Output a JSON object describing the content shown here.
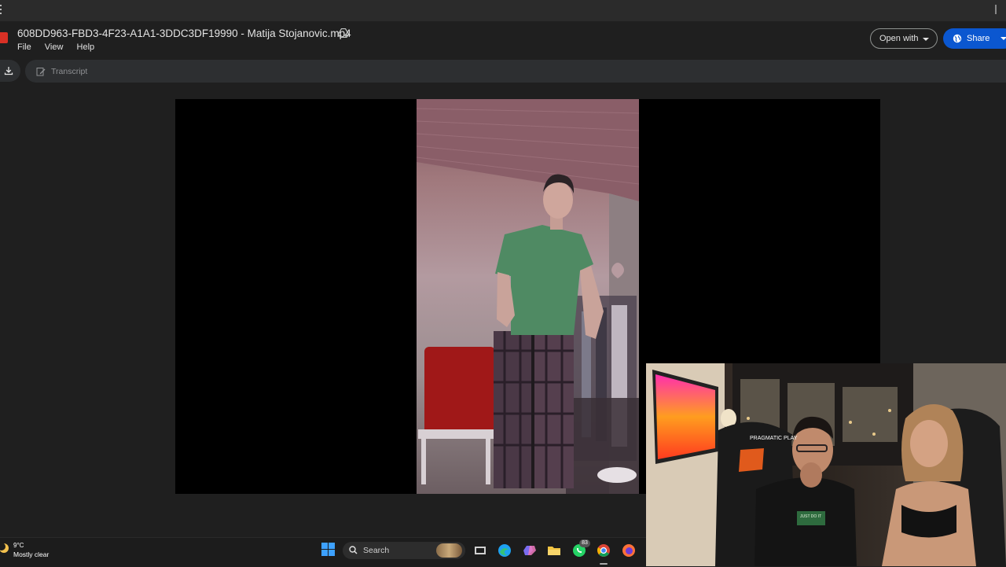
{
  "file": {
    "title": "608DD963-FBD3-4F23-A1A1-3DDC3DF19990 - Matija Stojanovic.mp4",
    "menu": [
      "File",
      "View",
      "Help"
    ]
  },
  "actions": {
    "open_with": "Open with",
    "share": "Share"
  },
  "toolbar": {
    "transcript": "Transcript"
  },
  "taskbar": {
    "weather_temp": "9°C",
    "weather_desc": "Mostly clear",
    "search_label": "Search",
    "whatsapp_badge": "83",
    "icons": [
      "windows-start-icon",
      "search-icon",
      "task-view-icon",
      "edge-icon",
      "copilot-icon",
      "file-explorer-icon",
      "whatsapp-icon",
      "chrome-icon",
      "firefox-icon"
    ]
  },
  "webcam": {
    "chair_text": "PRAGMATIC PLAY",
    "shirt_text": "JUST DO IT"
  },
  "colors": {
    "share_button": "#0b57d0",
    "background": "#1f1f1f",
    "player": "#000000"
  }
}
